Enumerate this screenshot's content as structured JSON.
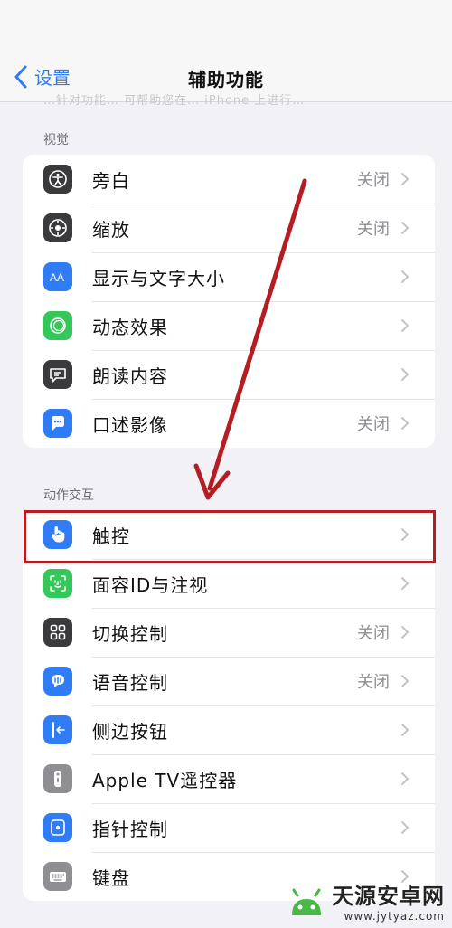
{
  "nav": {
    "back_label": "设置",
    "title": "辅助功能"
  },
  "peek_text": "…针对功能… 可帮助您在… iPhone 上进行…",
  "sections": {
    "vision": {
      "title": "视觉",
      "items": [
        {
          "label": "旁白",
          "value": "关闭",
          "icon": "accessibility-person-icon",
          "color": "#3a3a3c"
        },
        {
          "label": "缩放",
          "value": "关闭",
          "icon": "zoom-target-icon",
          "color": "#3a3a3c"
        },
        {
          "label": "显示与文字大小",
          "value": "",
          "icon": "text-size-icon",
          "color": "#2f7cf6"
        },
        {
          "label": "动态效果",
          "value": "",
          "icon": "motion-circle-icon",
          "color": "#34c759"
        },
        {
          "label": "朗读内容",
          "value": "",
          "icon": "speech-bubble-icon",
          "color": "#3a3a3c"
        },
        {
          "label": "口述影像",
          "value": "关闭",
          "icon": "audio-description-icon",
          "color": "#2f7cf6"
        }
      ]
    },
    "interaction": {
      "title": "动作交互",
      "items": [
        {
          "label": "触控",
          "value": "",
          "icon": "hand-touch-icon",
          "color": "#2f7cf6"
        },
        {
          "label": "面容ID与注视",
          "value": "",
          "icon": "face-id-icon",
          "color": "#34c759"
        },
        {
          "label": "切换控制",
          "value": "关闭",
          "icon": "switch-grid-icon",
          "color": "#3a3a3c"
        },
        {
          "label": "语音控制",
          "value": "关闭",
          "icon": "voice-control-icon",
          "color": "#2f7cf6"
        },
        {
          "label": "侧边按钮",
          "value": "",
          "icon": "side-button-icon",
          "color": "#2f7cf6"
        },
        {
          "label": "Apple TV遥控器",
          "value": "",
          "icon": "tv-remote-icon",
          "color": "#8e8e93"
        },
        {
          "label": "指针控制",
          "value": "",
          "icon": "pointer-control-icon",
          "color": "#2f7cf6"
        },
        {
          "label": "键盘",
          "value": "",
          "icon": "keyboard-icon",
          "color": "#8e8e93"
        }
      ]
    }
  },
  "watermark": {
    "name": "天源安卓网",
    "url": "www.jytyaz.com"
  },
  "colors": {
    "accent": "#2f7cf6",
    "annotation": "#b41e22",
    "background": "#f1f1f6"
  }
}
